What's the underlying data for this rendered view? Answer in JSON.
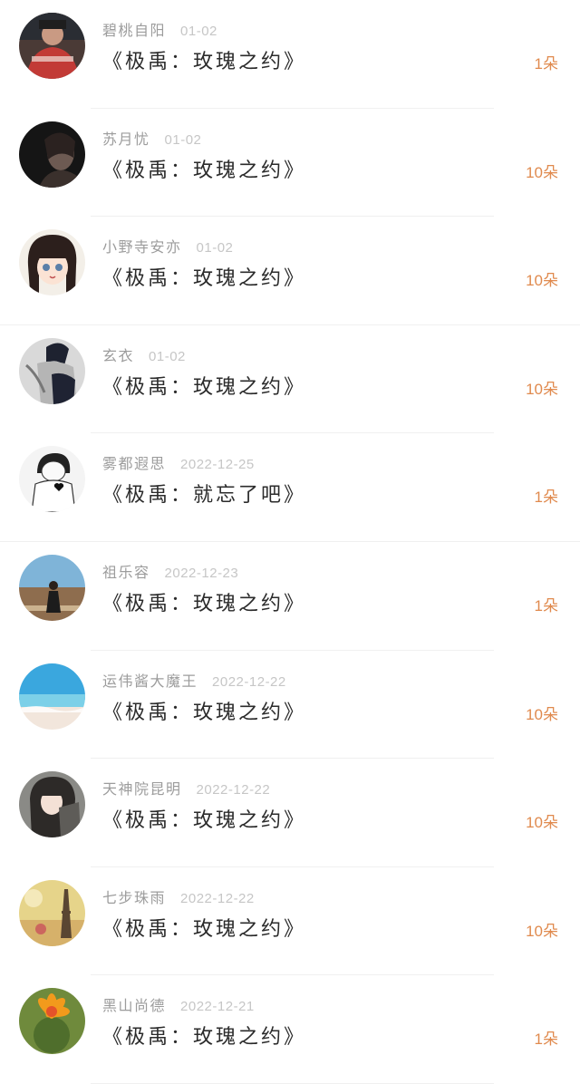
{
  "items": [
    {
      "user": "碧桃自阳",
      "date": "01-02",
      "title": "《极禹：玫瑰之约》",
      "count": "1朵",
      "avatar": "photo-person-red-shirt"
    },
    {
      "user": "苏月忧",
      "date": "01-02",
      "title": "《极禹：玫瑰之约》",
      "count": "10朵",
      "avatar": "photo-dark-portrait"
    },
    {
      "user": "小野寺安亦",
      "date": "01-02",
      "title": "《极禹：玫瑰之约》",
      "count": "10朵",
      "avatar": "anime-girl-dark-hair"
    },
    {
      "user": "玄衣",
      "date": "01-02",
      "title": "《极禹：玫瑰之约》",
      "count": "10朵",
      "avatar": "photo-bw-figure"
    },
    {
      "user": "雾都遐思",
      "date": "2022-12-25",
      "title": "《极禹：就忘了吧》",
      "count": "1朵",
      "avatar": "sketch-heart-character"
    },
    {
      "user": "祖乐容",
      "date": "2022-12-23",
      "title": "《极禹：玫瑰之约》",
      "count": "1朵",
      "avatar": "photo-girl-on-road"
    },
    {
      "user": "运伟酱大魔王",
      "date": "2022-12-22",
      "title": "《极禹：玫瑰之约》",
      "count": "10朵",
      "avatar": "photo-beach-sky"
    },
    {
      "user": "天神院昆明",
      "date": "2022-12-22",
      "title": "《极禹：玫瑰之约》",
      "count": "10朵",
      "avatar": "anime-girl-hood"
    },
    {
      "user": "七步珠雨",
      "date": "2022-12-22",
      "title": "《极禹：玫瑰之约》",
      "count": "10朵",
      "avatar": "photo-eiffel-tower"
    },
    {
      "user": "黑山尚德",
      "date": "2022-12-21",
      "title": "《极禹：玫瑰之约》",
      "count": "1朵",
      "avatar": "photo-cactus-flower"
    }
  ],
  "colors": {
    "count": "#e08a4e",
    "name": "#9c9c9c",
    "date": "#c6c6c6",
    "title": "#2b2b2b"
  }
}
